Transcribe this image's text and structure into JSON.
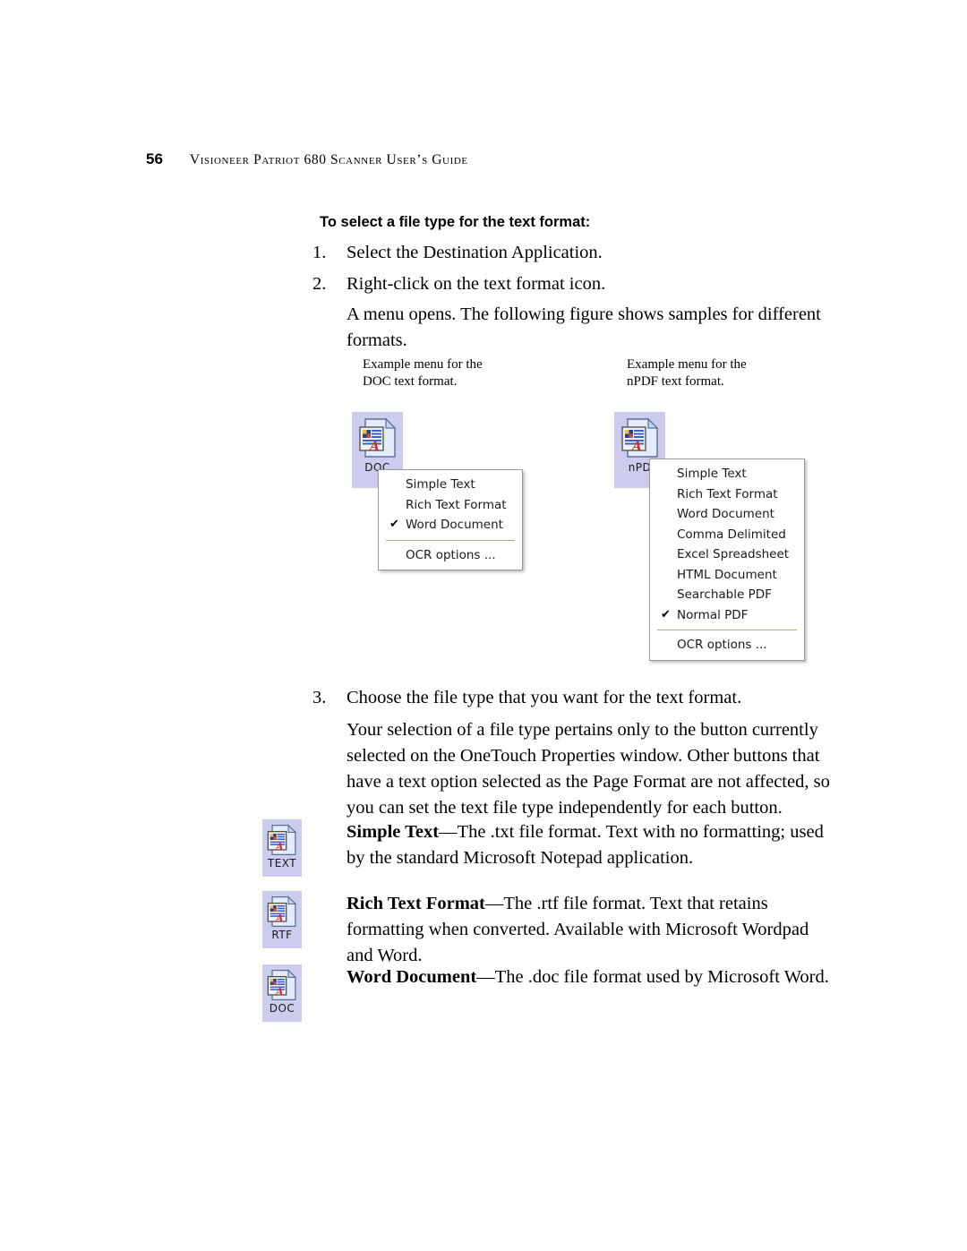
{
  "header": {
    "page_number": "56",
    "title": "Visioneer Patriot 680 Scanner User’s Guide"
  },
  "section": {
    "heading": "To select a file type for the text format:",
    "steps": [
      {
        "num": "1.",
        "text": "Select the Destination Application."
      },
      {
        "num": "2.",
        "text": "Right-click on the text format icon."
      }
    ],
    "after_step2": "A menu opens. The following figure shows samples for different formats.",
    "step3_num": "3.",
    "step3_text": "Choose the file type that you want for the text format.",
    "step3_para": "Your selection of a file type pertains only to the button currently selected on the OneTouch Properties window. Other buttons that have a text option selected as the Page Format are not affected, so you can set the text file type independently for each button."
  },
  "figure": {
    "left_caption_line1": "Example menu for the",
    "left_caption_line2": "DOC text format.",
    "right_caption_line1": "Example menu for the",
    "right_caption_line2": "nPDF text format.",
    "left_tile_label": "DOC",
    "right_tile_label": "nPD",
    "left_menu": {
      "items": [
        {
          "label": "Simple Text",
          "checked": false
        },
        {
          "label": "Rich Text Format",
          "checked": false
        },
        {
          "label": "Word Document",
          "checked": true
        }
      ],
      "footer_item": "OCR options ..."
    },
    "right_menu": {
      "items": [
        {
          "label": "Simple Text",
          "checked": false
        },
        {
          "label": "Rich Text Format",
          "checked": false
        },
        {
          "label": "Word Document",
          "checked": false
        },
        {
          "label": "Comma Delimited",
          "checked": false
        },
        {
          "label": "Excel Spreadsheet",
          "checked": false
        },
        {
          "label": "HTML Document",
          "checked": false
        },
        {
          "label": "Searchable PDF",
          "checked": false
        },
        {
          "label": "Normal PDF",
          "checked": true
        }
      ],
      "footer_item": "OCR options ..."
    },
    "check_glyph": "✔"
  },
  "formats": [
    {
      "tile_label": "TEXT",
      "name": "Simple Text",
      "dash": "—",
      "description": "The .txt file format. Text with no formatting; used by the standard Microsoft Notepad application."
    },
    {
      "tile_label": "RTF",
      "name": "Rich Text Format",
      "dash": "—",
      "description": "The .rtf file format. Text that retains formatting when converted. Available with Microsoft Wordpad and Word."
    },
    {
      "tile_label": "DOC",
      "name": "Word Document",
      "dash": "—",
      "description": "The .doc file format used by Microsoft Word."
    }
  ],
  "colors": {
    "tile_background": "#ccccee",
    "menu_background": "#ffffff",
    "menu_border": "#9a9a9a",
    "menu_separator": "#b0a98c",
    "page_background": "#ffffff",
    "text": "#000000",
    "icon_page": "#dfe8f7",
    "icon_outline": "#5a6b8c",
    "icon_letter_a": "#c8302a",
    "icon_lines": "#3a5fd0"
  }
}
